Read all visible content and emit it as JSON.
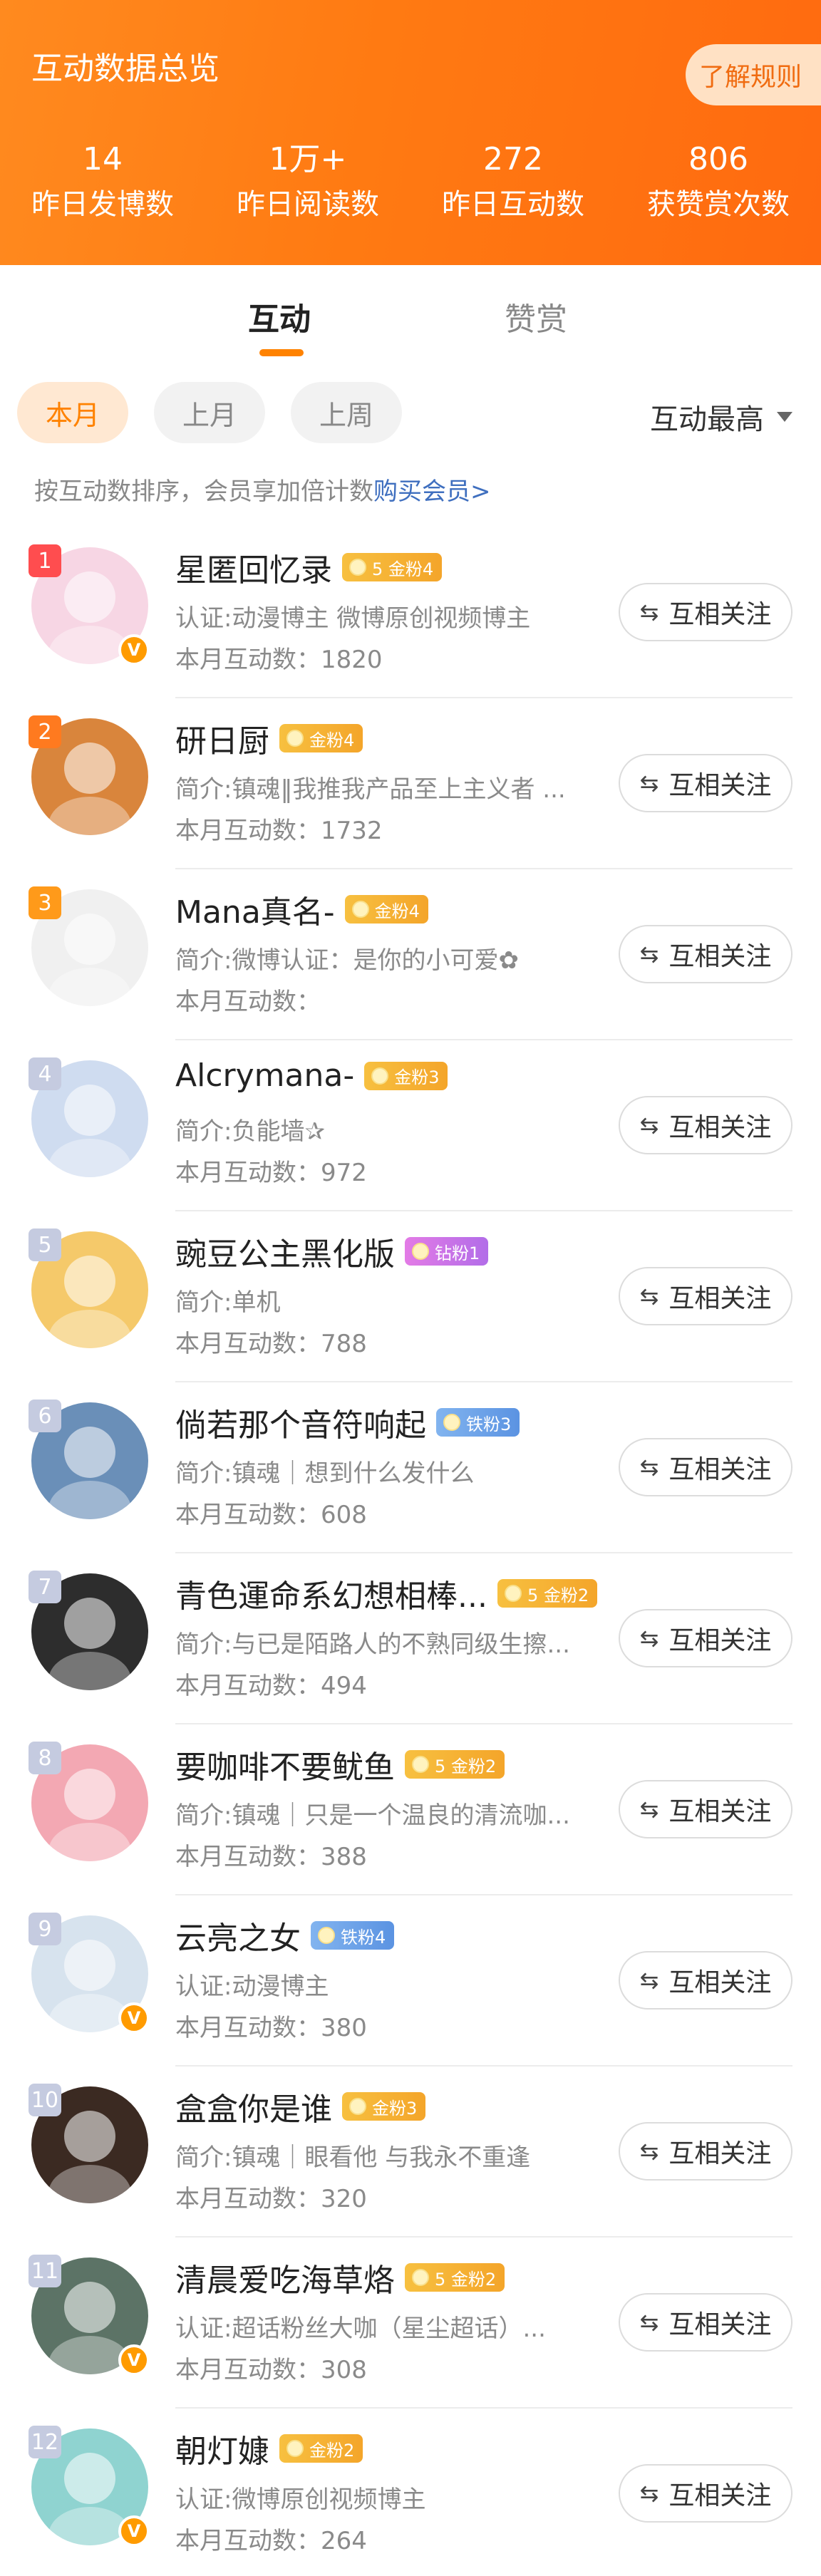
{
  "header": {
    "title": "互动数据总览",
    "rules_button": "了解规则",
    "stats": [
      {
        "value": "14",
        "label": "昨日发博数"
      },
      {
        "value": "1万+",
        "label": "昨日阅读数"
      },
      {
        "value": "272",
        "label": "昨日互动数"
      },
      {
        "value": "806",
        "label": "获赞赏次数"
      }
    ]
  },
  "tabs": {
    "interaction": "互动",
    "reward": "赞赏"
  },
  "filters": {
    "this_month": "本月",
    "last_month": "上月",
    "last_week": "上周",
    "sort": "互动最高"
  },
  "hint": {
    "text": "按互动数排序，会员享加倍计数",
    "link": "购买会员>"
  },
  "follow_label": "互相关注",
  "follow_icon": "⇆",
  "colors": {
    "accent": "#ff8200",
    "rank_top": [
      "#ff4d4f",
      "#ff7a1f",
      "#ff9a1a"
    ],
    "rank_other": "#c5cbe0"
  },
  "users": [
    {
      "rank": "1",
      "name": "星匿回忆录",
      "fan": "5 金粉4",
      "fan_type": "gold",
      "desc": "认证:动漫博主 微博原创视频博主",
      "count": "本月互动数：1820",
      "verified": true,
      "avatar_color": "#f7d6e4"
    },
    {
      "rank": "2",
      "name": "研日厨",
      "fan": "金粉4",
      "fan_type": "gold",
      "desc": "简介:镇魂‖我推我产品至上主义者 ...",
      "count": "本月互动数：1732",
      "verified": false,
      "avatar_color": "#d9853c"
    },
    {
      "rank": "3",
      "name": "Mana真名-",
      "fan": "金粉4",
      "fan_type": "gold",
      "desc": "简介:微博认证：是你的小可爱✿",
      "count": "本月互动数：",
      "verified": false,
      "avatar_color": "#f0f0f0"
    },
    {
      "rank": "4",
      "name": "Alcrymana-",
      "fan": "金粉3",
      "fan_type": "gold",
      "desc": "简介:负能墙✰",
      "count": "本月互动数：972",
      "verified": false,
      "avatar_color": "#cfdcf0"
    },
    {
      "rank": "5",
      "name": "豌豆公主黑化版",
      "fan": "钻粉1",
      "fan_type": "diamond",
      "desc": "简介:单机",
      "count": "本月互动数：788",
      "verified": false,
      "avatar_color": "#f5c96a"
    },
    {
      "rank": "6",
      "name": "倘若那个音符响起",
      "fan": "铁粉3",
      "fan_type": "iron",
      "desc": "简介:镇魂｜想到什么发什么",
      "count": "本月互动数：608",
      "verified": false,
      "avatar_color": "#6a8fb8"
    },
    {
      "rank": "7",
      "name": "青色運命系幻想相棒...",
      "fan": "5 金粉2",
      "fan_type": "gold",
      "desc": "简介:与已是陌路人的不熟同级生擦...",
      "count": "本月互动数：494",
      "verified": false,
      "avatar_color": "#2d2d2d"
    },
    {
      "rank": "8",
      "name": "要咖啡不要鱿鱼",
      "fan": "5 金粉2",
      "fan_type": "gold",
      "desc": "简介:镇魂｜只是一个温良的清流咖...",
      "count": "本月互动数：388",
      "verified": false,
      "avatar_color": "#f3a8b3"
    },
    {
      "rank": "9",
      "name": "云亮之女",
      "fan": "铁粉4",
      "fan_type": "iron",
      "desc": "认证:动漫博主",
      "count": "本月互动数：380",
      "verified": true,
      "avatar_color": "#d7e3ee"
    },
    {
      "rank": "10",
      "name": "盒盒你是谁",
      "fan": "金粉3",
      "fan_type": "gold",
      "desc": "简介:镇魂｜眼看他 与我永不重逢",
      "count": "本月互动数：320",
      "verified": false,
      "avatar_color": "#3b2a22"
    },
    {
      "rank": "11",
      "name": "清晨爱吃海草烙",
      "fan": "5 金粉2",
      "fan_type": "gold",
      "desc": "认证:超话粉丝大咖（星尘超话）...",
      "count": "本月互动数：308",
      "verified": true,
      "avatar_color": "#5c7366"
    },
    {
      "rank": "12",
      "name": "朝灯嫝",
      "fan": "金粉2",
      "fan_type": "gold",
      "desc": "认证:微博原创视频博主",
      "count": "本月互动数：264",
      "verified": true,
      "avatar_color": "#8fd3d0"
    }
  ]
}
